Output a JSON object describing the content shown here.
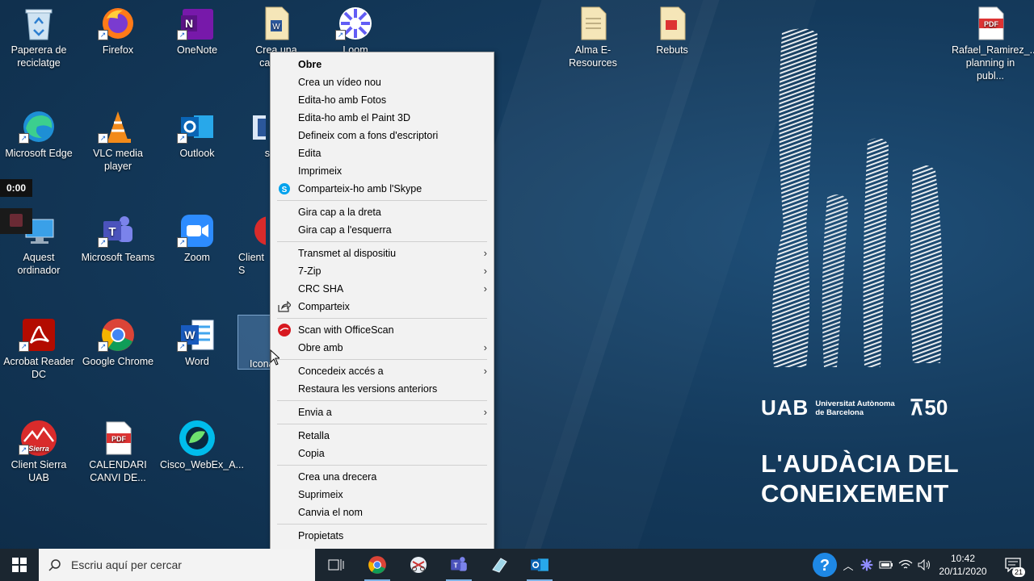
{
  "desktop": {
    "icons": [
      {
        "label": "Paperera de reciclatge"
      },
      {
        "label": "Firefox"
      },
      {
        "label": "OneNote"
      },
      {
        "label": "Crea una carpeta"
      },
      {
        "label": "Loom"
      },
      {
        "label": "Alma E-Resources"
      },
      {
        "label": "Rebuts"
      },
      {
        "label": "Rafael_Ramirez_... planning in publ..."
      },
      {
        "label": "Microsoft Edge"
      },
      {
        "label": "VLC media player"
      },
      {
        "label": "Outlook"
      },
      {
        "label": "s"
      },
      {
        "label": "Aquest ordinador"
      },
      {
        "label": "Microsoft Teams"
      },
      {
        "label": "Zoom"
      },
      {
        "label": "Client S"
      },
      {
        "label": "Acrobat Reader DC"
      },
      {
        "label": "Google Chrome"
      },
      {
        "label": "Word"
      },
      {
        "label": "Icona"
      },
      {
        "label": "Client Sierra UAB"
      },
      {
        "label": "CALENDARI CANVI DE..."
      },
      {
        "label": "Cisco_WebEx_A..."
      }
    ],
    "timer": "0:00"
  },
  "brand": {
    "logo": "UAB",
    "university": "Universitat Autònoma de Barcelona",
    "anniversary": "50",
    "tagline_1": "L'AUDÀCIA DEL",
    "tagline_2": "CONEIXEMENT"
  },
  "context_menu": {
    "items": [
      "Obre",
      "Crea un vídeo nou",
      "Edita-ho amb Fotos",
      "Edita-ho amb el Paint 3D",
      "Defineix com a fons d'escriptori",
      "Edita",
      "Imprimeix",
      "Comparteix-ho amb l'Skype",
      "Gira cap a la dreta",
      "Gira cap a l'esquerra",
      "Transmet al dispositiu",
      "7-Zip",
      "CRC SHA",
      "Comparteix",
      "Scan with OfficeScan",
      "Obre amb",
      "Concedeix accés a",
      "Restaura les versions anteriors",
      "Envia a",
      "Retalla",
      "Copia",
      "Crea una drecera",
      "Suprimeix",
      "Canvia el nom",
      "Propietats"
    ]
  },
  "taskbar": {
    "search_placeholder": "Escriu aquí per cercar",
    "time": "10:42",
    "date": "20/11/2020",
    "notifications": "21",
    "help": "?"
  },
  "colors": {
    "desktop_bg": "#143a5c",
    "taskbar_bg": "#1b2630",
    "menu_bg": "#f2f2f2"
  }
}
